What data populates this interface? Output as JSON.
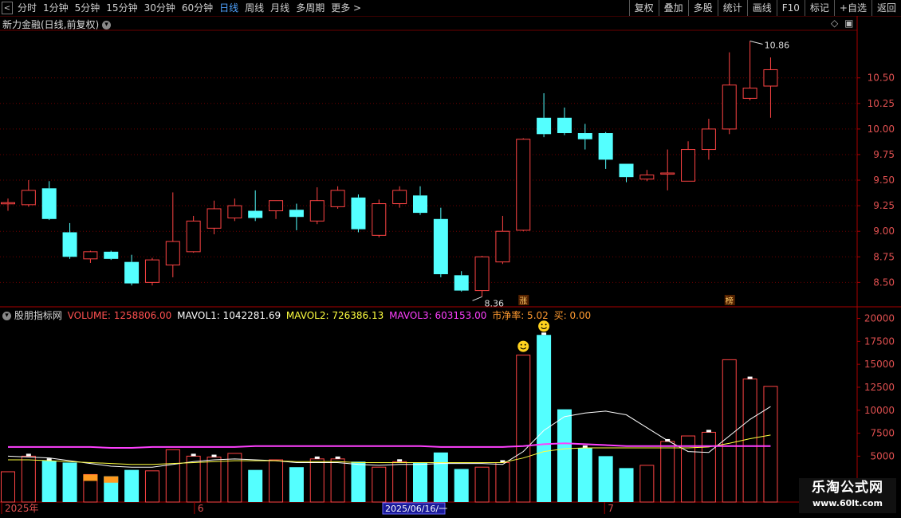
{
  "toolbar": {
    "back_glyph": "<",
    "periods": [
      "分时",
      "1分钟",
      "5分钟",
      "15分钟",
      "30分钟",
      "60分钟",
      "日线",
      "周线",
      "月线",
      "多周期",
      "更多 >"
    ],
    "active_period": "日线",
    "right_buttons": [
      "复权",
      "叠加",
      "多股",
      "统计",
      "画线",
      "F10",
      "标记",
      "+自选",
      "返回"
    ]
  },
  "main_panel": {
    "title": "新力金融(日线,前复权)",
    "max_label": "10.86",
    "min_label": "8.36",
    "badge_zhang": "涨",
    "badge_bang": "榜"
  },
  "volume_panel": {
    "name": "股朋指标网",
    "volume": "VOLUME: 1258806.00",
    "mavol1": "MAVOL1: 1042281.69",
    "mavol2": "MAVOL2: 726386.13",
    "mavol3": "MAVOL3: 603153.00",
    "pb": "市净率: 5.02",
    "buy": "买: 0.00"
  },
  "date_axis": {
    "labels": [
      "2025年",
      "6",
      "7"
    ],
    "cursor_label": "2025/06/16/一"
  },
  "watermark": {
    "line1": "乐淘公式网",
    "line2": "www.60lt.com"
  },
  "colors": {
    "up": "#ff4444",
    "down": "#54ffff",
    "ma1": "#ffffff",
    "ma2": "#ffff40",
    "ma3": "#ff40ff",
    "grid": "#6a0000",
    "axis_text": "#e05050"
  },
  "chart_data": [
    {
      "type": "candlestick",
      "ylim": [
        8.3,
        10.95
      ],
      "yticks": [
        8.5,
        8.75,
        9.0,
        9.25,
        9.5,
        9.75,
        10.0,
        10.25,
        10.5
      ],
      "grid": true,
      "candles": [
        {
          "o": 9.28,
          "h": 9.32,
          "l": 9.2,
          "c": 9.28
        },
        {
          "o": 9.26,
          "h": 9.5,
          "l": 9.24,
          "c": 9.4
        },
        {
          "o": 9.42,
          "h": 9.49,
          "l": 9.11,
          "c": 9.12
        },
        {
          "o": 8.99,
          "h": 9.08,
          "l": 8.73,
          "c": 8.75
        },
        {
          "o": 8.73,
          "h": 8.81,
          "l": 8.69,
          "c": 8.8
        },
        {
          "o": 8.8,
          "h": 8.81,
          "l": 8.72,
          "c": 8.73
        },
        {
          "o": 8.7,
          "h": 8.77,
          "l": 8.47,
          "c": 8.49
        },
        {
          "o": 8.5,
          "h": 8.74,
          "l": 8.47,
          "c": 8.72
        },
        {
          "o": 8.67,
          "h": 9.38,
          "l": 8.55,
          "c": 8.9
        },
        {
          "o": 8.8,
          "h": 9.15,
          "l": 8.79,
          "c": 9.1
        },
        {
          "o": 9.03,
          "h": 9.3,
          "l": 8.97,
          "c": 9.22
        },
        {
          "o": 9.13,
          "h": 9.32,
          "l": 9.1,
          "c": 9.25
        },
        {
          "o": 9.2,
          "h": 9.4,
          "l": 9.1,
          "c": 9.13
        },
        {
          "o": 9.2,
          "h": 9.29,
          "l": 9.12,
          "c": 9.3
        },
        {
          "o": 9.21,
          "h": 9.27,
          "l": 9.01,
          "c": 9.14
        },
        {
          "o": 9.1,
          "h": 9.43,
          "l": 9.07,
          "c": 9.3
        },
        {
          "o": 9.24,
          "h": 9.44,
          "l": 9.22,
          "c": 9.4
        },
        {
          "o": 9.33,
          "h": 9.36,
          "l": 8.99,
          "c": 9.02
        },
        {
          "o": 8.96,
          "h": 9.31,
          "l": 8.94,
          "c": 9.27
        },
        {
          "o": 9.27,
          "h": 9.44,
          "l": 9.23,
          "c": 9.4
        },
        {
          "o": 9.35,
          "h": 9.44,
          "l": 9.16,
          "c": 9.18
        },
        {
          "o": 9.12,
          "h": 9.23,
          "l": 8.55,
          "c": 8.58
        },
        {
          "o": 8.57,
          "h": 8.61,
          "l": 8.41,
          "c": 8.42
        },
        {
          "o": 8.42,
          "h": 8.76,
          "l": 8.36,
          "c": 8.75
        },
        {
          "o": 8.7,
          "h": 9.15,
          "l": 8.68,
          "c": 9.0
        },
        {
          "o": 9.01,
          "h": 9.91,
          "l": 9.0,
          "c": 9.9
        },
        {
          "o": 10.11,
          "h": 10.35,
          "l": 9.92,
          "c": 9.95
        },
        {
          "o": 10.11,
          "h": 10.21,
          "l": 9.94,
          "c": 9.96
        },
        {
          "o": 9.96,
          "h": 10.05,
          "l": 9.8,
          "c": 9.9
        },
        {
          "o": 9.96,
          "h": 9.97,
          "l": 9.61,
          "c": 9.7
        },
        {
          "o": 9.66,
          "h": 9.66,
          "l": 9.48,
          "c": 9.53
        },
        {
          "o": 9.51,
          "h": 9.6,
          "l": 9.49,
          "c": 9.55
        },
        {
          "o": 9.56,
          "h": 9.8,
          "l": 9.4,
          "c": 9.57
        },
        {
          "o": 9.49,
          "h": 9.88,
          "l": 9.49,
          "c": 9.8
        },
        {
          "o": 9.8,
          "h": 10.1,
          "l": 9.7,
          "c": 10.0
        },
        {
          "o": 10.0,
          "h": 10.75,
          "l": 9.95,
          "c": 10.43
        },
        {
          "o": 10.3,
          "h": 10.86,
          "l": 10.28,
          "c": 10.4
        },
        {
          "o": 10.42,
          "h": 10.7,
          "l": 10.11,
          "c": 10.58
        }
      ]
    },
    {
      "type": "bar",
      "ylim": [
        0,
        21000
      ],
      "yticks": [
        5000,
        7500,
        10000,
        12500,
        15000,
        17500,
        20000
      ],
      "grid": false,
      "series": [
        {
          "values": [
            3300,
            5000,
            4500,
            4300,
            3000,
            2800,
            3500,
            3400,
            5700,
            5000,
            4900,
            5300,
            3500,
            4600,
            3800,
            4700,
            4700,
            4400,
            3800,
            4400,
            4300,
            5400,
            3600,
            3800,
            4300,
            16000,
            18200,
            10100,
            5900,
            5000,
            3700,
            4000,
            6600,
            7200,
            7600,
            15500,
            13400,
            12600
          ]
        },
        {
          "name": "MAVOL1",
          "values": [
            5000,
            4900,
            4800,
            4500,
            4200,
            3900,
            3800,
            3800,
            4100,
            4400,
            4600,
            4700,
            4600,
            4500,
            4300,
            4300,
            4300,
            4100,
            4000,
            4100,
            4100,
            4200,
            4200,
            4200,
            4100,
            5500,
            7800,
            9300,
            9700,
            9900,
            9500,
            8100,
            6700,
            5500,
            5400,
            7200,
            9000,
            10400
          ]
        },
        {
          "name": "MAVOL2",
          "values": [
            4600,
            4600,
            4500,
            4400,
            4300,
            4200,
            4100,
            4100,
            4200,
            4300,
            4400,
            4500,
            4500,
            4500,
            4400,
            4400,
            4400,
            4300,
            4300,
            4300,
            4300,
            4300,
            4300,
            4300,
            4300,
            4800,
            5500,
            5800,
            5900,
            5900,
            5900,
            5900,
            5900,
            5900,
            6000,
            6400,
            6900,
            7300
          ]
        },
        {
          "name": "MAVOL3",
          "values": [
            6000,
            6000,
            6000,
            6000,
            6000,
            5900,
            5900,
            6000,
            6000,
            6000,
            6000,
            6000,
            6100,
            6100,
            6100,
            6100,
            6100,
            6100,
            6100,
            6100,
            6100,
            6000,
            6000,
            6000,
            6000,
            6100,
            6300,
            6400,
            6300,
            6200,
            6100,
            6100,
            6100,
            6100,
            6100,
            6100,
            6100,
            6100
          ]
        }
      ],
      "up_flags": [
        true,
        true,
        false,
        false,
        true,
        false,
        false,
        true,
        true,
        true,
        true,
        true,
        false,
        true,
        false,
        true,
        true,
        false,
        true,
        true,
        false,
        false,
        false,
        true,
        true,
        true,
        false,
        false,
        false,
        false,
        false,
        true,
        true,
        true,
        true,
        true,
        true,
        true
      ],
      "highlight_orange": [
        4,
        5
      ]
    }
  ]
}
